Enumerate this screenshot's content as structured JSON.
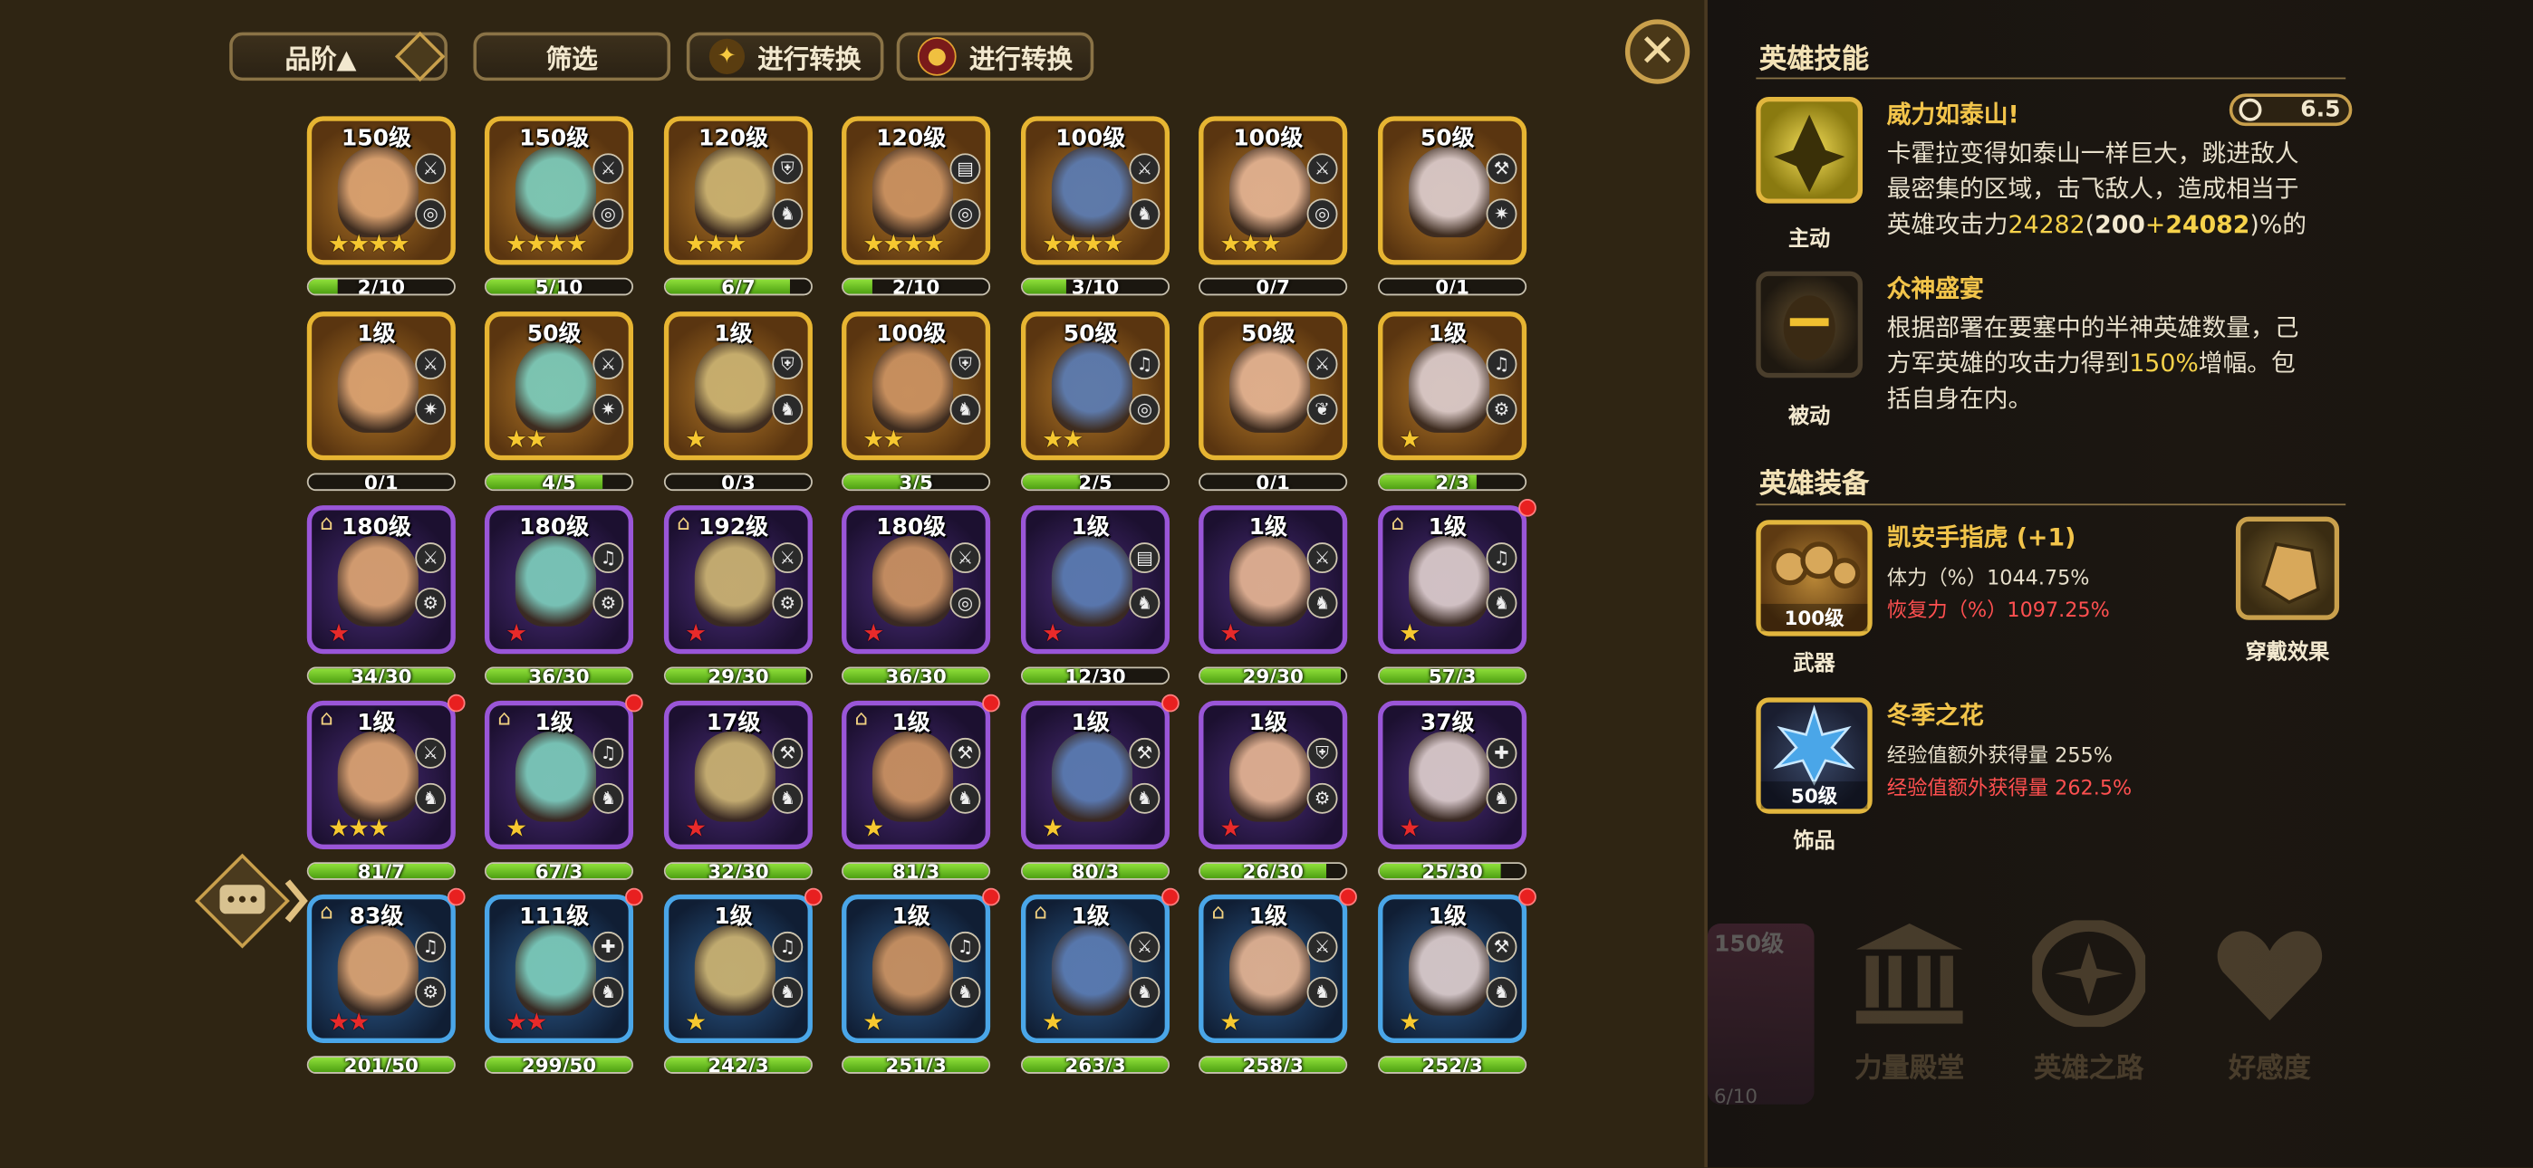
{
  "toolbar": {
    "sort_label": "品阶▲",
    "filter_label": "筛选",
    "convert1_label": "进行转换",
    "convert2_label": "进行转换",
    "close_symbol": "✕"
  },
  "colors": {
    "gold": "#e7b532",
    "purple": "#9a56d8",
    "blue": "#4aa6e8",
    "accent": "#f2c44a",
    "red_stat": "#ff5050"
  },
  "heroes": [
    {
      "level": "150级",
      "frame": "gold",
      "stars": "★★★★",
      "star_color": "gold",
      "progress": "2/10",
      "fill": 0.2,
      "icons": [
        "sword-icon",
        "orb-icon"
      ],
      "hanger": false,
      "dot": false
    },
    {
      "level": "150级",
      "frame": "gold",
      "stars": "★★★★",
      "star_color": "gold",
      "progress": "5/10",
      "fill": 0.5,
      "icons": [
        "sword-icon",
        "orb-icon"
      ],
      "hanger": false,
      "dot": false
    },
    {
      "level": "120级",
      "frame": "gold",
      "stars": "★★★",
      "star_color": "gold",
      "progress": "6/7",
      "fill": 0.86,
      "icons": [
        "shield-icon",
        "beast-icon"
      ],
      "hanger": false,
      "dot": false
    },
    {
      "level": "120级",
      "frame": "gold",
      "stars": "★★★★",
      "star_color": "gold",
      "progress": "2/10",
      "fill": 0.2,
      "icons": [
        "book-icon",
        "orb-icon"
      ],
      "hanger": false,
      "dot": false
    },
    {
      "level": "100级",
      "frame": "gold",
      "stars": "★★★★",
      "star_color": "gold",
      "progress": "3/10",
      "fill": 0.3,
      "icons": [
        "sword-icon",
        "beast-icon"
      ],
      "hanger": false,
      "dot": false
    },
    {
      "level": "100级",
      "frame": "gold",
      "stars": "★★★",
      "star_color": "gold",
      "progress": "0/7",
      "fill": 0.0,
      "icons": [
        "sword-icon",
        "orb-icon"
      ],
      "hanger": false,
      "dot": false
    },
    {
      "level": "50级",
      "frame": "gold",
      "stars": "",
      "star_color": "gold",
      "progress": "0/1",
      "fill": 0.0,
      "icons": [
        "axe-icon",
        "star-orb-icon"
      ],
      "hanger": false,
      "dot": false
    },
    {
      "level": "1级",
      "frame": "gold",
      "stars": "",
      "star_color": "gold",
      "progress": "0/1",
      "fill": 0.0,
      "icons": [
        "sword-icon",
        "star-orb-icon"
      ],
      "hanger": false,
      "dot": false
    },
    {
      "level": "50级",
      "frame": "gold",
      "stars": "★★",
      "star_color": "gold",
      "progress": "4/5",
      "fill": 0.8,
      "icons": [
        "sword-icon",
        "star-orb-icon"
      ],
      "hanger": false,
      "dot": false
    },
    {
      "level": "1级",
      "frame": "gold",
      "stars": "★",
      "star_color": "gold",
      "progress": "0/3",
      "fill": 0.0,
      "icons": [
        "shield-icon",
        "beast-icon"
      ],
      "hanger": false,
      "dot": false
    },
    {
      "level": "100级",
      "frame": "gold",
      "stars": "★★",
      "star_color": "gold",
      "progress": "3/5",
      "fill": 0.6,
      "icons": [
        "shield-icon",
        "beast-icon"
      ],
      "hanger": false,
      "dot": false
    },
    {
      "level": "50级",
      "frame": "gold",
      "stars": "★★",
      "star_color": "gold",
      "progress": "2/5",
      "fill": 0.4,
      "icons": [
        "harp-icon",
        "orb-icon"
      ],
      "hanger": false,
      "dot": false
    },
    {
      "level": "50级",
      "frame": "gold",
      "stars": "",
      "star_color": "gold",
      "progress": "0/1",
      "fill": 0.0,
      "icons": [
        "sword-icon",
        "leaf-icon"
      ],
      "hanger": false,
      "dot": false
    },
    {
      "level": "1级",
      "frame": "gold",
      "stars": "★",
      "star_color": "gold",
      "progress": "2/3",
      "fill": 0.67,
      "icons": [
        "harp-icon",
        "machine-icon"
      ],
      "hanger": false,
      "dot": false
    },
    {
      "level": "180级",
      "frame": "purple",
      "stars": "★",
      "star_color": "red",
      "progress": "34/30",
      "fill": 1.0,
      "icons": [
        "sword-icon",
        "machine-icon"
      ],
      "hanger": true,
      "dot": false
    },
    {
      "level": "180级",
      "frame": "purple",
      "stars": "★",
      "star_color": "red",
      "progress": "36/30",
      "fill": 1.0,
      "icons": [
        "harp-icon",
        "machine-icon"
      ],
      "hanger": false,
      "dot": false
    },
    {
      "level": "192级",
      "frame": "purple",
      "stars": "★",
      "star_color": "red",
      "progress": "29/30",
      "fill": 0.97,
      "icons": [
        "sword-icon",
        "machine-icon"
      ],
      "hanger": true,
      "dot": false
    },
    {
      "level": "180级",
      "frame": "purple",
      "stars": "★",
      "star_color": "red",
      "progress": "36/30",
      "fill": 1.0,
      "icons": [
        "sword-icon",
        "orb-icon"
      ],
      "hanger": false,
      "dot": false
    },
    {
      "level": "1级",
      "frame": "purple",
      "stars": "★",
      "star_color": "red",
      "progress": "12/30",
      "fill": 0.4,
      "icons": [
        "book-icon",
        "beast-icon"
      ],
      "hanger": false,
      "dot": false
    },
    {
      "level": "1级",
      "frame": "purple",
      "stars": "★",
      "star_color": "red",
      "progress": "29/30",
      "fill": 0.97,
      "icons": [
        "sword-icon",
        "beast-icon"
      ],
      "hanger": false,
      "dot": false
    },
    {
      "level": "1级",
      "frame": "purple",
      "stars": "★",
      "star_color": "gold",
      "progress": "57/3",
      "fill": 1.0,
      "icons": [
        "harp-icon",
        "beast-icon"
      ],
      "hanger": true,
      "dot": true
    },
    {
      "level": "1级",
      "frame": "purple",
      "stars": "★★★",
      "star_color": "gold",
      "progress": "81/7",
      "fill": 1.0,
      "icons": [
        "sword-icon",
        "beast-icon"
      ],
      "hanger": true,
      "dot": true
    },
    {
      "level": "1级",
      "frame": "purple",
      "stars": "★",
      "star_color": "gold",
      "progress": "67/3",
      "fill": 1.0,
      "icons": [
        "harp-icon",
        "beast-icon"
      ],
      "hanger": true,
      "dot": true
    },
    {
      "level": "17级",
      "frame": "purple",
      "stars": "★",
      "star_color": "red",
      "progress": "32/30",
      "fill": 1.0,
      "icons": [
        "axe-icon",
        "beast-icon"
      ],
      "hanger": false,
      "dot": false
    },
    {
      "level": "1级",
      "frame": "purple",
      "stars": "★",
      "star_color": "gold",
      "progress": "81/3",
      "fill": 1.0,
      "icons": [
        "axe-icon",
        "beast-icon"
      ],
      "hanger": true,
      "dot": true
    },
    {
      "level": "1级",
      "frame": "purple",
      "stars": "★",
      "star_color": "gold",
      "progress": "80/3",
      "fill": 1.0,
      "icons": [
        "axe-icon",
        "beast-icon"
      ],
      "hanger": false,
      "dot": true
    },
    {
      "level": "1级",
      "frame": "purple",
      "stars": "★",
      "star_color": "red",
      "progress": "26/30",
      "fill": 0.87,
      "icons": [
        "shield-icon",
        "machine-icon"
      ],
      "hanger": false,
      "dot": false
    },
    {
      "level": "37级",
      "frame": "purple",
      "stars": "★",
      "star_color": "red",
      "progress": "25/30",
      "fill": 0.83,
      "icons": [
        "cross-icon",
        "beast-icon"
      ],
      "hanger": false,
      "dot": false
    },
    {
      "level": "83级",
      "frame": "blue",
      "stars": "★★",
      "star_color": "red",
      "progress": "201/50",
      "fill": 1.0,
      "icons": [
        "harp-icon",
        "machine-icon"
      ],
      "hanger": true,
      "dot": true
    },
    {
      "level": "111级",
      "frame": "blue",
      "stars": "★★",
      "star_color": "red",
      "progress": "299/50",
      "fill": 1.0,
      "icons": [
        "cross-icon",
        "beast-icon"
      ],
      "hanger": false,
      "dot": true
    },
    {
      "level": "1级",
      "frame": "blue",
      "stars": "★",
      "star_color": "gold",
      "progress": "242/3",
      "fill": 1.0,
      "icons": [
        "harp-icon",
        "beast-icon"
      ],
      "hanger": false,
      "dot": true
    },
    {
      "level": "1级",
      "frame": "blue",
      "stars": "★",
      "star_color": "gold",
      "progress": "251/3",
      "fill": 1.0,
      "icons": [
        "harp-icon",
        "beast-icon"
      ],
      "hanger": false,
      "dot": true
    },
    {
      "level": "1级",
      "frame": "blue",
      "stars": "★",
      "star_color": "gold",
      "progress": "263/3",
      "fill": 1.0,
      "icons": [
        "sword-icon",
        "beast-icon"
      ],
      "hanger": true,
      "dot": true
    },
    {
      "level": "1级",
      "frame": "blue",
      "stars": "★",
      "star_color": "gold",
      "progress": "258/3",
      "fill": 1.0,
      "icons": [
        "sword-icon",
        "beast-icon"
      ],
      "hanger": true,
      "dot": true
    },
    {
      "level": "1级",
      "frame": "blue",
      "stars": "★",
      "star_color": "gold",
      "progress": "252/3",
      "fill": 1.0,
      "icons": [
        "axe-icon",
        "beast-icon"
      ],
      "hanger": false,
      "dot": true
    }
  ],
  "panel": {
    "skills_title": "英雄技能",
    "active": {
      "name": "威力如泰山!",
      "type": "主动",
      "cooldown": "6.5",
      "desc_l1": "卡霍拉变得如泰山一样巨大，跳进敌人",
      "desc_l2": "最密集的区域，击飞敌人，造成相当于",
      "desc_pre": "英雄攻击力",
      "atk_total": "24282",
      "atk_paren_open": "(",
      "atk_base": "200",
      "atk_plus": "+",
      "atk_bonus": "24082",
      "atk_paren_close": ")",
      "desc_post": "%的"
    },
    "passive": {
      "name": "众神盛宴",
      "type": "被动",
      "desc_l1": "根据部署在要塞中的半神英雄数量，己",
      "desc_l2_pre": "方军英雄的攻击力得到",
      "desc_pct": "150%",
      "desc_l2_post": "增幅。包",
      "desc_l3": "括自身在内。"
    },
    "equip_title": "英雄装备",
    "weapon": {
      "name": "凯安手指虎 (+1)",
      "level": "100级",
      "slot": "武器",
      "stat1": "体力（%）1044.75%",
      "stat2": "恢复力（%）1097.25%"
    },
    "wear_effect": "穿戴效果",
    "accessory": {
      "name": "冬季之花",
      "level": "50级",
      "slot": "饰品",
      "stat1": "经验值额外获得量 255%",
      "stat2": "经验值额外获得量 262.5%"
    },
    "bg_hero": {
      "level": "150级",
      "progress": "6/10"
    },
    "nav": [
      "力量殿堂",
      "英雄之路",
      "好感度"
    ]
  }
}
